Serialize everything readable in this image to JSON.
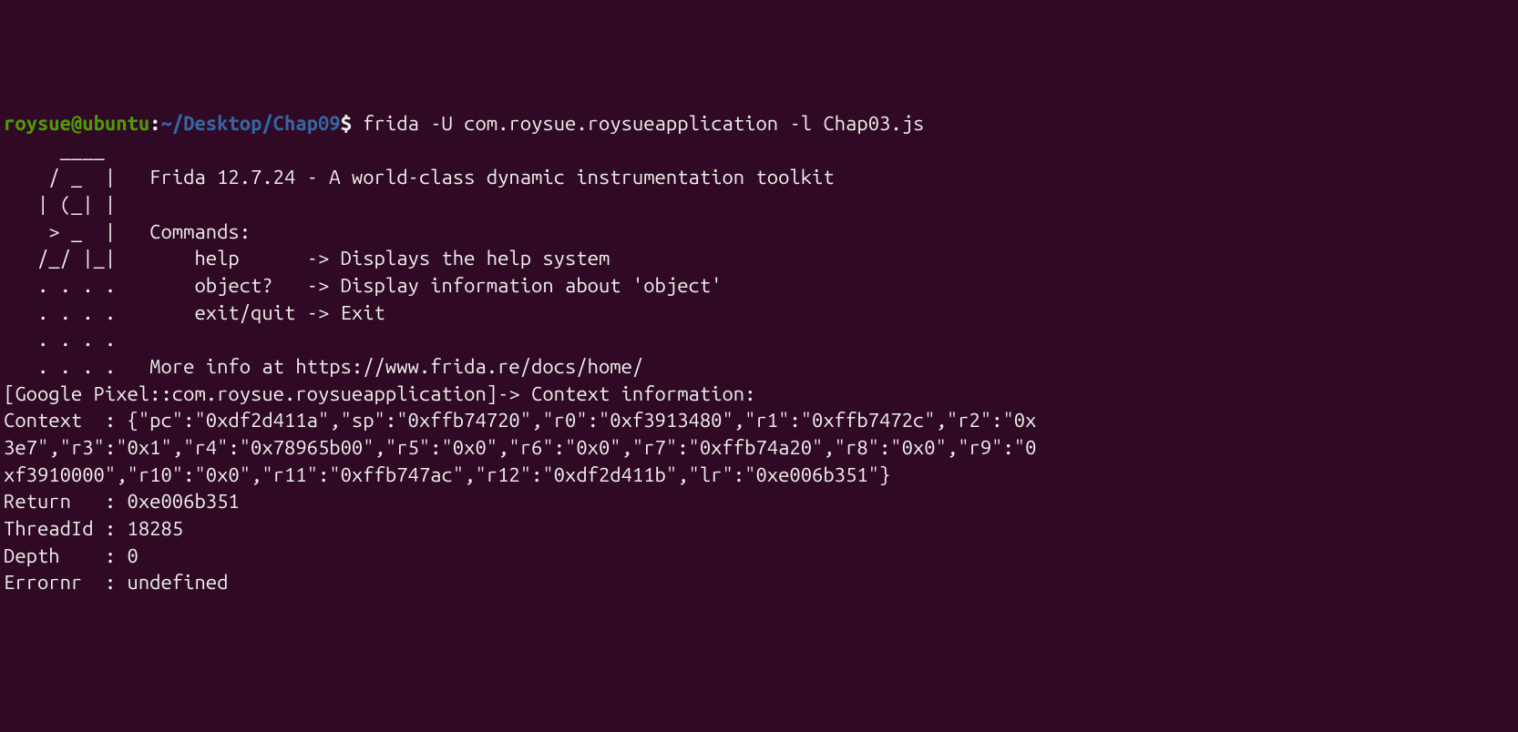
{
  "prompt": {
    "user": "roysue",
    "at": "@",
    "host": "ubuntu",
    "colon": ":",
    "tilde": "~",
    "path": "/Desktop/Chap09",
    "dollar": "$"
  },
  "command": " frida -U com.roysue.roysueapplication -l Chap03.js",
  "banner": {
    "line1": "     ____",
    "line2": "    / _  |   Frida 12.7.24 - A world-class dynamic instrumentation toolkit",
    "line3": "   | (_| |",
    "line4": "    > _  |   Commands:",
    "line5": "   /_/ |_|       help      -> Displays the help system",
    "line6": "   . . . .       object?   -> Display information about 'object'",
    "line7": "   . . . .       exit/quit -> Exit",
    "line8": "   . . . .",
    "line9": "   . . . .   More info at https://www.frida.re/docs/home/",
    "blank": ""
  },
  "session": {
    "prompt": "[Google Pixel::com.roysue.roysueapplication]-> Context information:",
    "context_line1": "Context  : {\"pc\":\"0xdf2d411a\",\"sp\":\"0xffb74720\",\"r0\":\"0xf3913480\",\"r1\":\"0xffb7472c\",\"r2\":\"0x",
    "context_line2": "3e7\",\"r3\":\"0x1\",\"r4\":\"0x78965b00\",\"r5\":\"0x0\",\"r6\":\"0x0\",\"r7\":\"0xffb74a20\",\"r8\":\"0x0\",\"r9\":\"0",
    "context_line3": "xf3910000\",\"r10\":\"0x0\",\"r11\":\"0xffb747ac\",\"r12\":\"0xdf2d411b\",\"lr\":\"0xe006b351\"}",
    "return": "Return   : 0xe006b351",
    "threadid": "ThreadId : 18285",
    "depth": "Depth    : 0",
    "errornr": "Errornr  : undefined"
  }
}
